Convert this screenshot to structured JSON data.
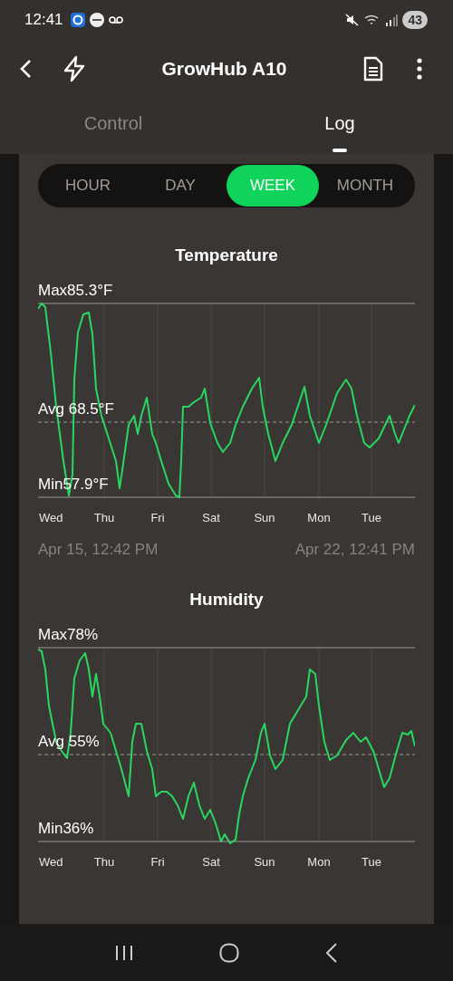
{
  "status_bar": {
    "time": "12:41",
    "battery": "43"
  },
  "header": {
    "title": "GrowHub A10"
  },
  "tabs": [
    {
      "label": "Control",
      "selected": false
    },
    {
      "label": "Log",
      "selected": true
    }
  ],
  "ranges": [
    {
      "label": "HOUR",
      "selected": false
    },
    {
      "label": "DAY",
      "selected": false
    },
    {
      "label": "WEEK",
      "selected": true
    },
    {
      "label": "MONTH",
      "selected": false
    }
  ],
  "charts": [
    {
      "title": "Temperature",
      "max_label": "Max85.3°F",
      "avg_label": "Avg 68.5°F",
      "min_label": "Min57.9°F",
      "days": [
        "Wed",
        "Thu",
        "Fri",
        "Sat",
        "Sun",
        "Mon",
        "Tue"
      ],
      "start": "Apr 15, 12:42 PM",
      "end": "Apr 22, 12:41 PM"
    },
    {
      "title": "Humidity",
      "max_label": "Max78%",
      "avg_label": "Avg 55%",
      "min_label": "Min36%",
      "days": [
        "Wed",
        "Thu",
        "Fri",
        "Sat",
        "Sun",
        "Mon",
        "Tue"
      ]
    }
  ]
}
